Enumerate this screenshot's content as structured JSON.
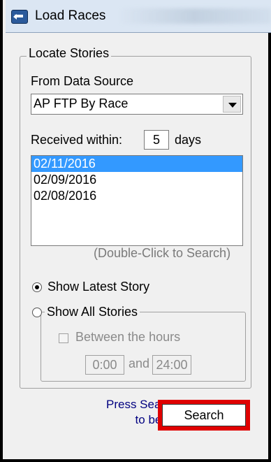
{
  "window": {
    "title": "Load Races"
  },
  "locate_group": {
    "label": "Locate Stories"
  },
  "data_source": {
    "label": "From Data Source",
    "value": "AP FTP By Race"
  },
  "received": {
    "label": "Received within:",
    "value": "5",
    "unit": "days"
  },
  "dates": {
    "items": [
      "02/11/2016",
      "02/09/2016",
      "02/08/2016"
    ],
    "selected_index": 0
  },
  "hint": "(Double-Click to Search)",
  "options": {
    "latest_label": "Show Latest Story",
    "all_label": "Show All Stories",
    "selected": "latest"
  },
  "hours": {
    "label": "Between the hours",
    "start": "0:00",
    "end": "24:00",
    "and_label": "and"
  },
  "footer": {
    "prompt_line1": "Press Search",
    "prompt_line2": "to begin",
    "search_label": "Search"
  }
}
